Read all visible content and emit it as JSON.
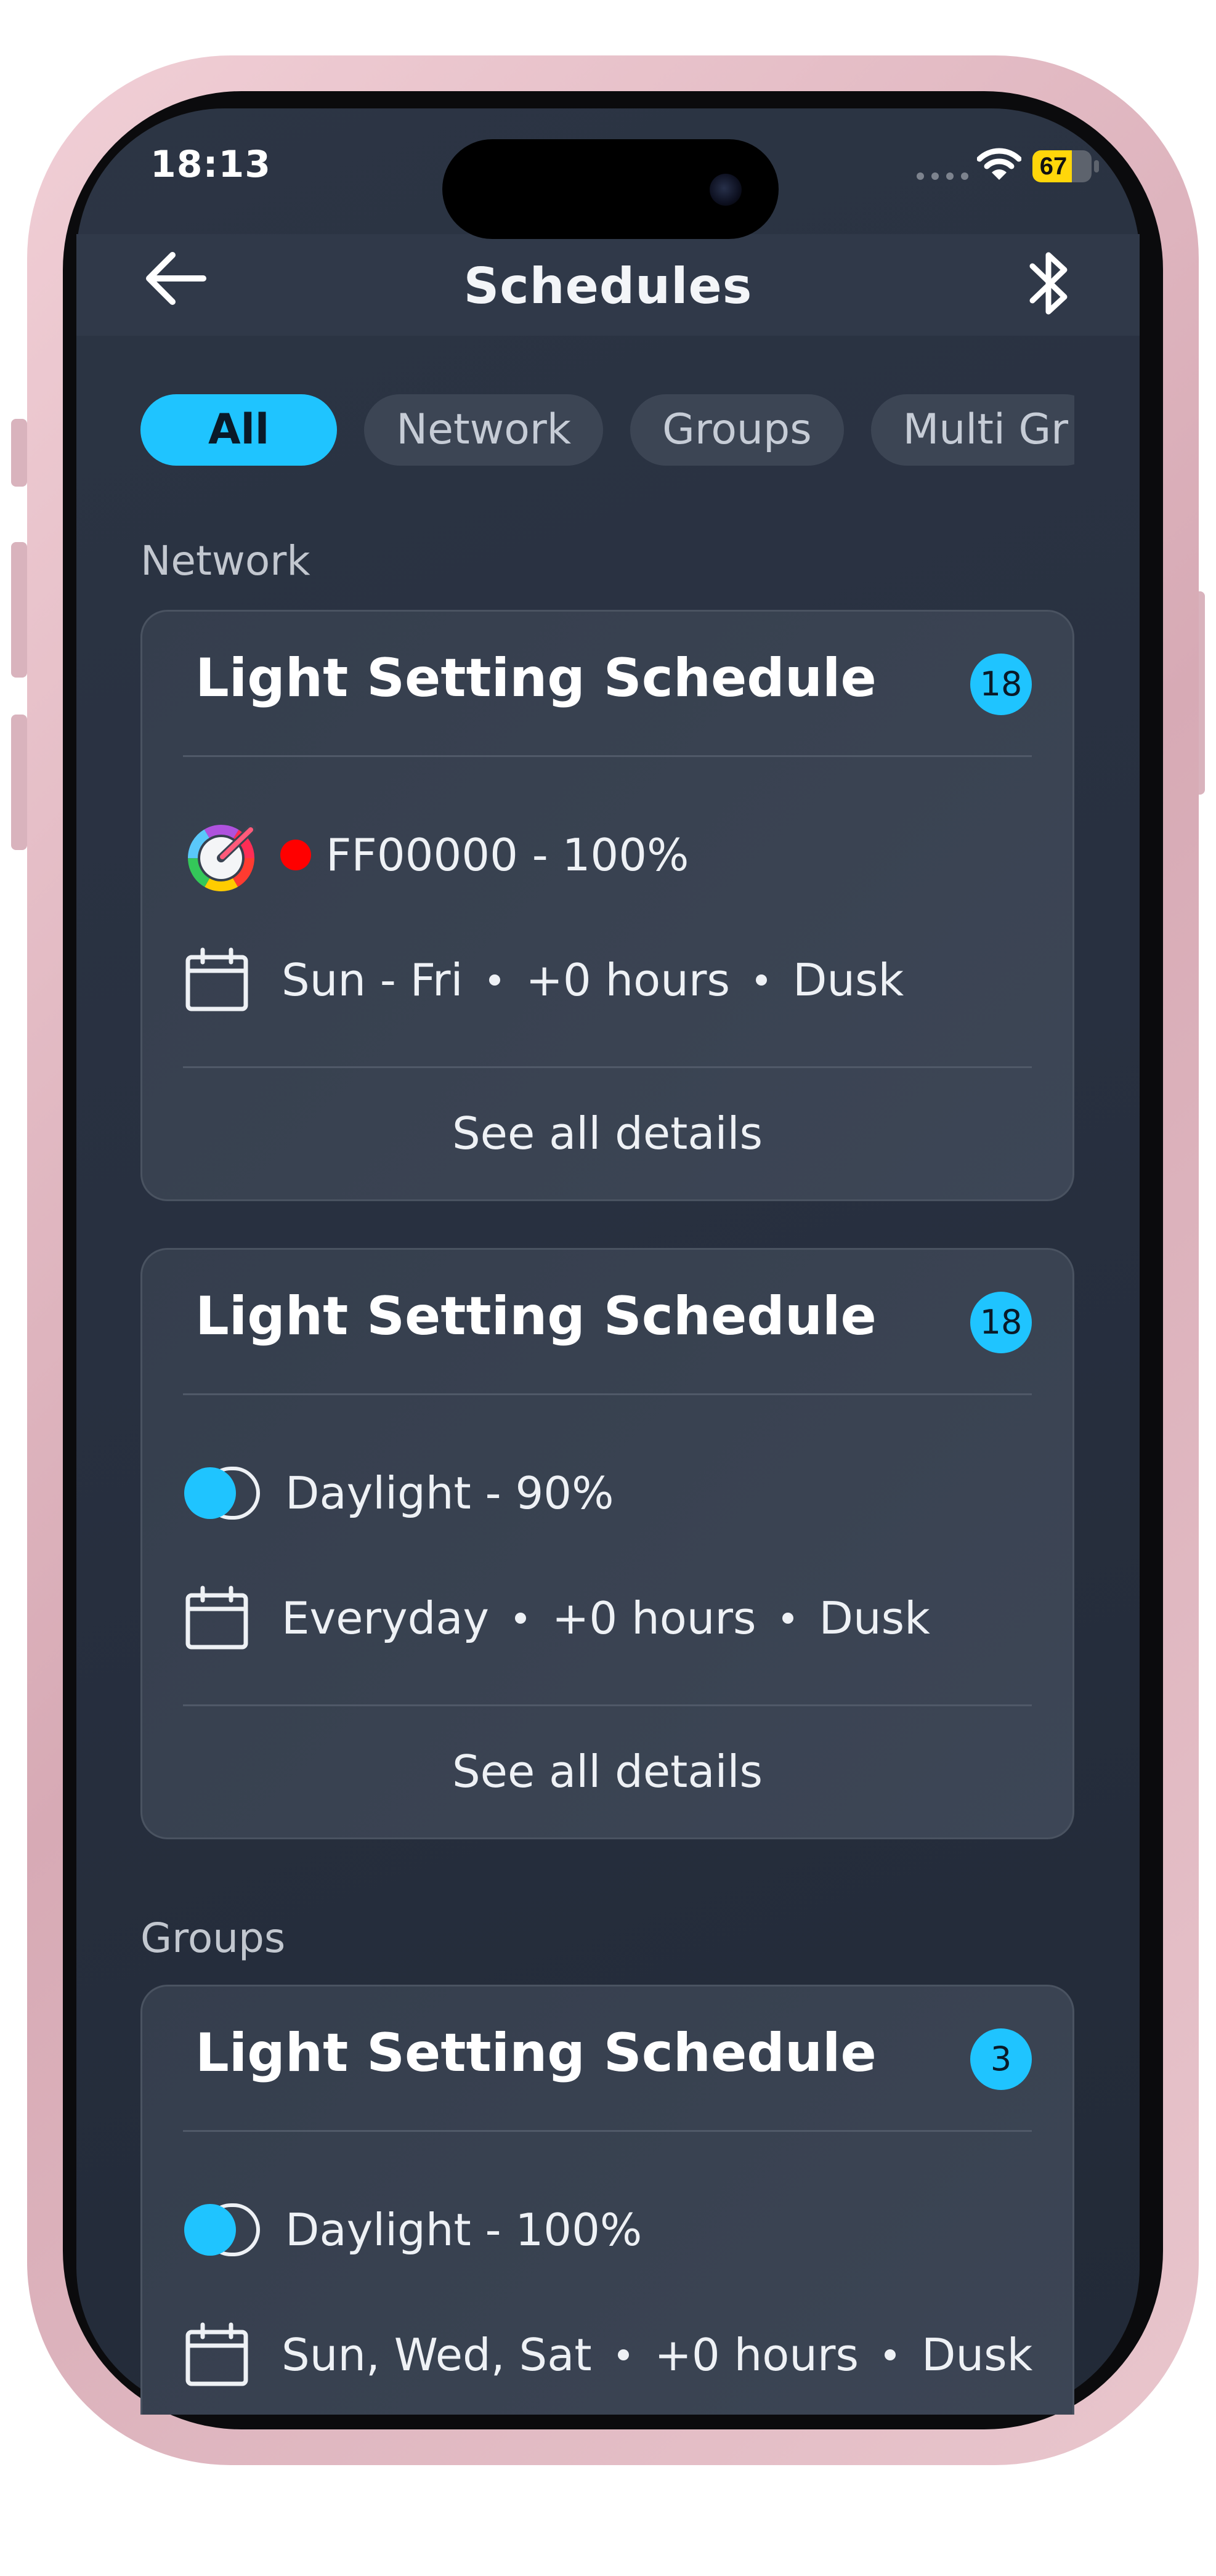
{
  "status_bar": {
    "time": "18:13",
    "battery_level": "67",
    "battery_fraction": 0.67
  },
  "navbar": {
    "title": "Schedules",
    "back_icon": "arrow-left-icon",
    "bluetooth_icon": "bluetooth-icon"
  },
  "filters": {
    "selected": "All",
    "chips": [
      "All",
      "Network",
      "Groups",
      "Multi Gr"
    ]
  },
  "sections": [
    {
      "label": "Network",
      "cards": [
        {
          "title": "Light Setting Schedule",
          "badge": "18",
          "setting_icon": "color-wheel-icon",
          "setting_color": "#ff0000",
          "setting_text": "FF00000 - 100%",
          "days": "Sun - Fri",
          "offset": "+0 hours",
          "trigger": "Dusk",
          "details_label": "See all details"
        },
        {
          "title": "Light Setting Schedule",
          "badge": "18",
          "setting_icon": "daylight-toggle-icon",
          "setting_text": "Daylight - 90%",
          "days": "Everyday",
          "offset": "+0 hours",
          "trigger": "Dusk",
          "details_label": "See all details"
        }
      ]
    },
    {
      "label": "Groups",
      "cards": [
        {
          "title": "Light Setting Schedule",
          "badge": "3",
          "setting_icon": "daylight-toggle-icon",
          "setting_text": "Daylight - 100%",
          "days": "Sun, Wed, Sat",
          "offset": "+0 hours",
          "trigger": "Dusk"
        }
      ]
    }
  ],
  "colors": {
    "accent": "#1fc4ff",
    "background": "#2a3240",
    "card": "#383f4d"
  }
}
